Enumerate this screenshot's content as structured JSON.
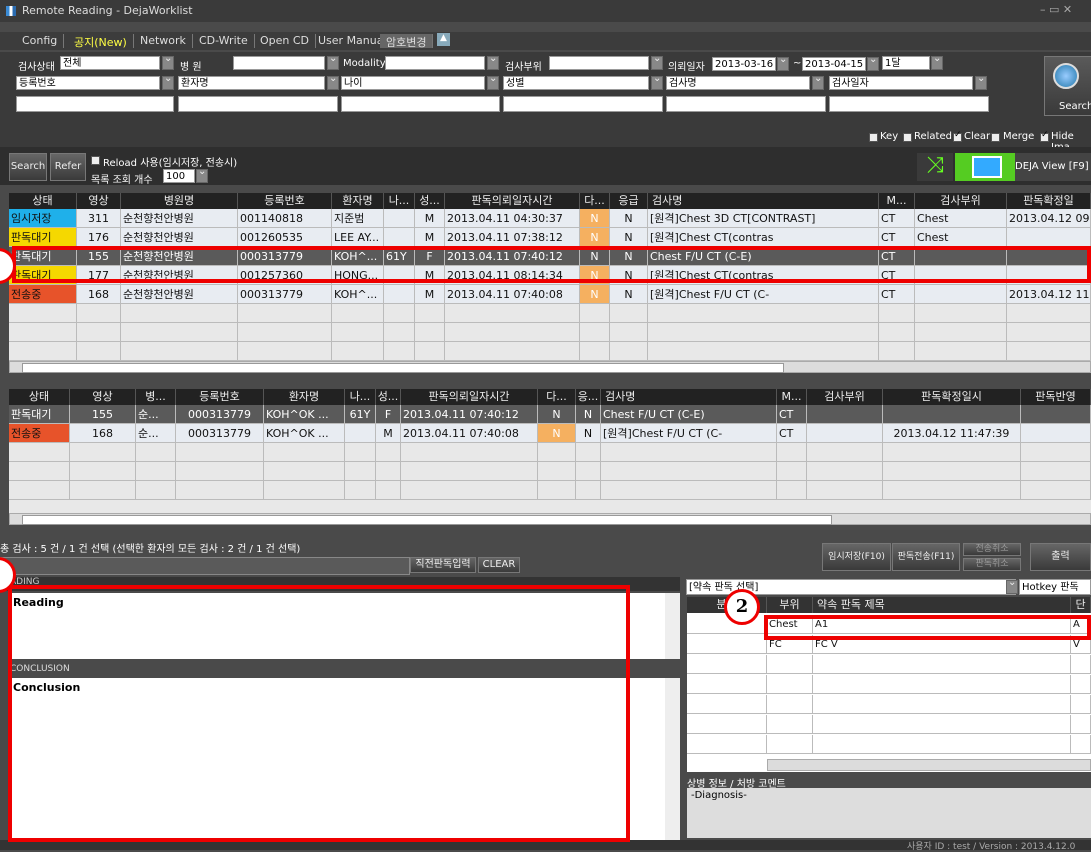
{
  "window": {
    "title": "Remote Reading - DejaWorklist"
  },
  "menu": [
    "Config",
    "공지(New)",
    "Network",
    "CD-Write",
    "Open CD",
    "User Manual",
    "암호변경"
  ],
  "filters": {
    "status_label": "검사상태",
    "status_value": "전체",
    "hospital_label": "병         원",
    "modality_label": "Modality",
    "bodypart_label": "검사부위",
    "reqdate_label": "의뢰일자",
    "date_from": "2013-03-16",
    "date_sep": "~",
    "date_to": "2013-04-15",
    "period": "1달",
    "regno_label": "등록번호",
    "patient_label": "환자명",
    "age_label": "나이",
    "sex_label": "성별",
    "exam_label": "검사명",
    "examdate_label": "검사일자",
    "search_label": "Search"
  },
  "options": {
    "key": "Key",
    "related": "Related",
    "clear": "Clear",
    "merge": "Merge",
    "hide": "Hide Ima"
  },
  "toolbar": {
    "search": "Search",
    "refer": "Refer",
    "reload": "Reload 사용(임시저장, 전송시)",
    "listcount_label": "목록 조회 개수",
    "listcount": "100",
    "deja_view": "DEJA View [F9]"
  },
  "grid1": {
    "headers": [
      "상태",
      "영상",
      "병원명",
      "등록번호",
      "환자명",
      "나...",
      "성...",
      "판독의뢰일자시간",
      "다...",
      "응급",
      "검사명",
      "M...",
      "검사부위",
      "판독확정일"
    ],
    "rows": [
      [
        "임시저장",
        "311",
        "순천향천안병원",
        "001140818",
        "지준범",
        "",
        "M",
        "2013.04.11 04:30:37",
        "N",
        "N",
        "[원격]Chest 3D CT[CONTRAST]",
        "CT",
        "Chest",
        "2013.04.12 09:"
      ],
      [
        "판독대기",
        "176",
        "순천향천안병원",
        "001260535",
        "LEE AY...",
        "",
        "M",
        "2013.04.11 07:38:12",
        "N",
        "N",
        "[원격]Chest CT(contras",
        "CT",
        "Chest",
        ""
      ],
      [
        "판독대기",
        "155",
        "순천향천안병원",
        "000313779",
        "KOH^...",
        "61Y",
        "F",
        "2013.04.11 07:40:12",
        "N",
        "N",
        "Chest F/U CT (C-E)",
        "CT",
        "",
        ""
      ],
      [
        "판독대기",
        "177",
        "순천향천안병원",
        "001257360",
        "HONG...",
        "",
        "M",
        "2013.04.11 08:14:34",
        "N",
        "N",
        "[원격]Chest CT(contras",
        "CT",
        "",
        ""
      ],
      [
        "전송중",
        "168",
        "순천향천안병원",
        "000313779",
        "KOH^...",
        "",
        "M",
        "2013.04.11 07:40:08",
        "N",
        "N",
        "[원격]Chest F/U CT (C-",
        "CT",
        "",
        "2013.04.12 11:"
      ]
    ]
  },
  "grid2": {
    "headers": [
      "상태",
      "영상",
      "병...",
      "등록번호",
      "환자명",
      "나...",
      "성...",
      "판독의뢰일자시간",
      "다...",
      "응...",
      "검사명",
      "M...",
      "검사부위",
      "판독확정일시",
      "판독반영"
    ],
    "rows": [
      [
        "판독대기",
        "155",
        "순...",
        "000313779",
        "KOH^OK ...",
        "61Y",
        "F",
        "2013.04.11 07:40:12",
        "N",
        "N",
        "Chest F/U CT (C-E)",
        "CT",
        "",
        "",
        ""
      ],
      [
        "전송중",
        "168",
        "순...",
        "000313779",
        "KOH^OK ...",
        "",
        "M",
        "2013.04.11 07:40:08",
        "N",
        "N",
        "[원격]Chest F/U CT (C-",
        "CT",
        "",
        "2013.04.12 11:47:39",
        ""
      ]
    ]
  },
  "summary": "총 검사 : 5 건 / 1 건 선택 (선택한 환자의 모든 검사 : 2 건 / 1 건 선택)",
  "reading": {
    "section": "ADING",
    "reading_text": "Reading",
    "conclusion_label": "CONCLUSION",
    "conclusion_text": "Conclusion",
    "prev_input": "직전판독입력",
    "clear": "CLEAR"
  },
  "right": {
    "temp_save": "임시저장(F10)",
    "send": "판독전송(F11)",
    "cancel_send": "전송취소",
    "cancel_read": "판독취소",
    "print": "출력",
    "template_select": "[약속 판독 선택]",
    "hotkey": "Hotkey 판독",
    "tmpl_headers": [
      "분류",
      "부위",
      "약속 판독 제목",
      "단"
    ],
    "tmpl_rows": [
      [
        "Chest",
        "A1",
        "A"
      ],
      [
        "FC",
        "FC V",
        "V"
      ]
    ],
    "comment_label": "상병 정보 / 처방 코멘트",
    "comment_text": "-Diagnosis-"
  },
  "status_bar": "사용자 ID : test / Version : 2013.4.12.0",
  "annotations": [
    "2"
  ]
}
